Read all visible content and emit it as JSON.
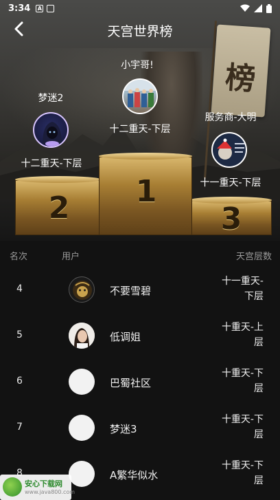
{
  "status": {
    "time": "3:34",
    "icon_a": "A",
    "icon_b": ""
  },
  "header": {
    "title": "天宫世界榜",
    "back": "‹"
  },
  "banner_char": "榜",
  "top3": [
    {
      "rank": "1",
      "name": "小宇哥!",
      "level": "十二重天-下层"
    },
    {
      "rank": "2",
      "name": "梦迷2",
      "level": "十二重天-下层"
    },
    {
      "rank": "3",
      "name": "服务商-大明",
      "level": "十一重天-下层"
    }
  ],
  "table": {
    "col_rank": "名次",
    "col_user": "用户",
    "col_level": "天宫层数"
  },
  "rows": [
    {
      "rank": "4",
      "name": "不要雪碧",
      "level": "十一重天-下层"
    },
    {
      "rank": "5",
      "name": "低调姐",
      "level": "十重天-上层"
    },
    {
      "rank": "6",
      "name": "巴蜀社区",
      "level": "十重天-下层"
    },
    {
      "rank": "7",
      "name": "梦迷3",
      "level": "十重天-下层"
    },
    {
      "rank": "8",
      "name": "A繁华似水",
      "level": "十重天-下层"
    }
  ],
  "watermark": {
    "main": "安心下载网",
    "sub": "www.java800.com"
  },
  "colors": {
    "background": "#121212",
    "gold": "#c9a24d",
    "text": "#ffffff",
    "muted": "#9a9a9a"
  }
}
